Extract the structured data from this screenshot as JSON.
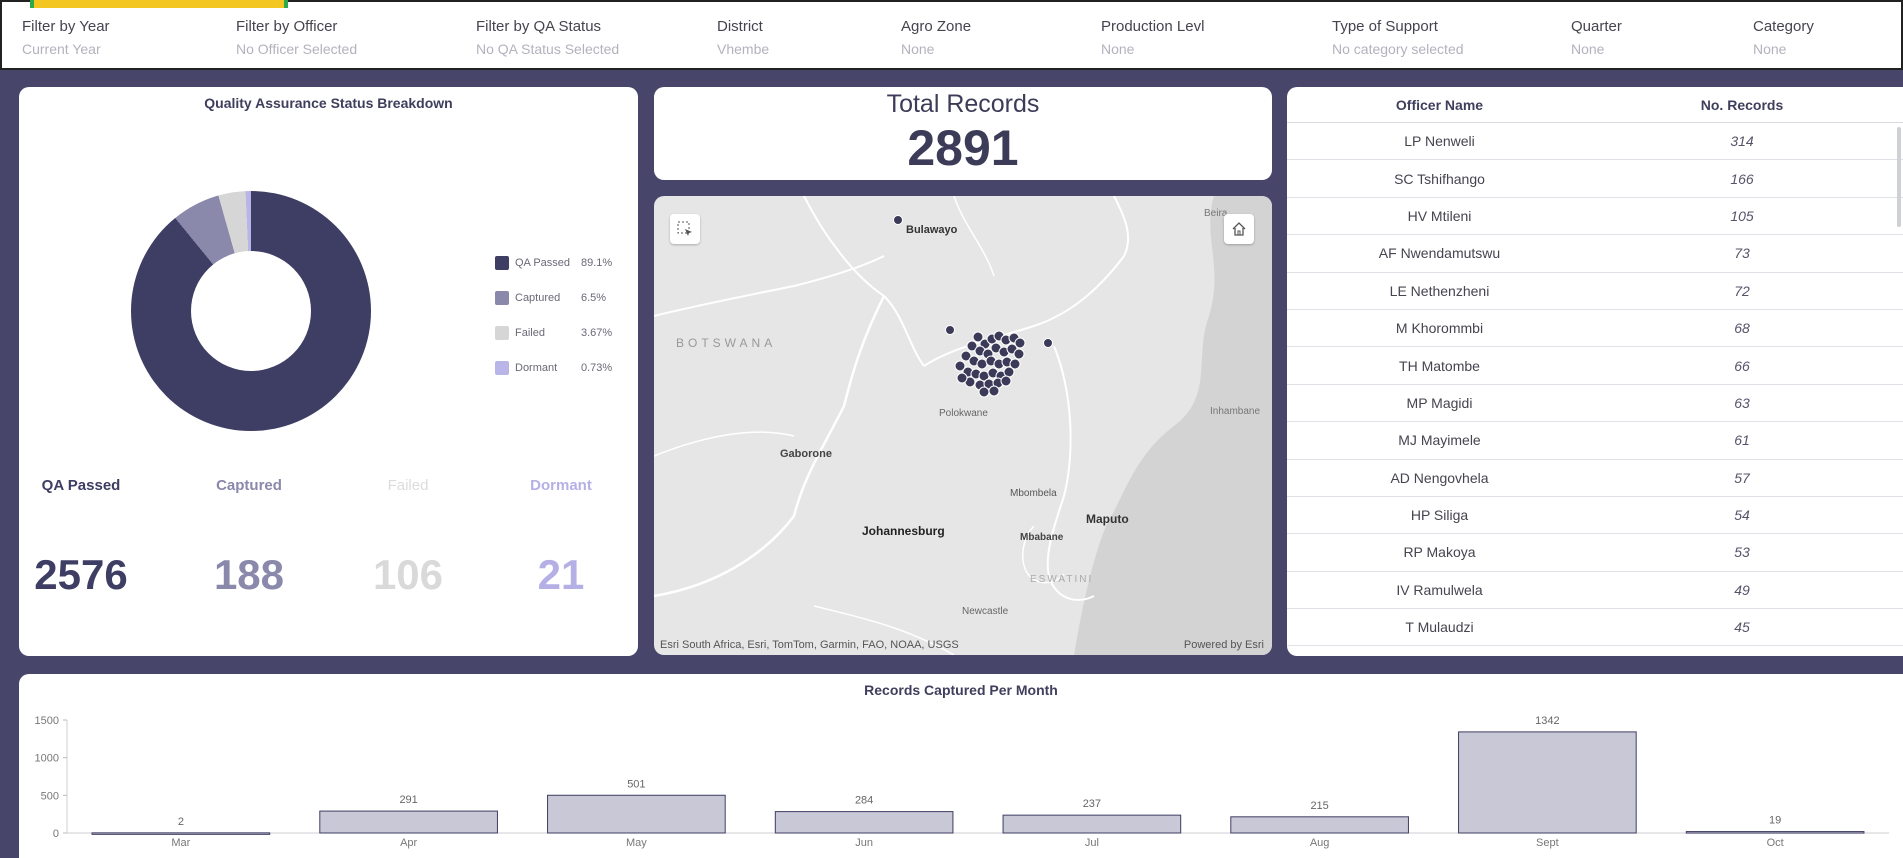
{
  "filters": [
    {
      "label": "Filter by Year",
      "value": "Current Year"
    },
    {
      "label": "Filter by Officer",
      "value": "No Officer Selected"
    },
    {
      "label": "Filter by QA Status",
      "value": "No QA Status Selected"
    },
    {
      "label": "District",
      "value": "Vhembe"
    },
    {
      "label": "Agro Zone",
      "value": "None"
    },
    {
      "label": "Production Levl",
      "value": "None"
    },
    {
      "label": "Type of Support",
      "value": "No category selected"
    },
    {
      "label": "Quarter",
      "value": "None"
    },
    {
      "label": "Category",
      "value": "None"
    }
  ],
  "qa": {
    "title": "Quality Assurance Status Breakdown",
    "legend": [
      {
        "label": "QA Passed",
        "pct": "89.1%",
        "color": "#3e3d63"
      },
      {
        "label": "Captured",
        "pct": "6.5%",
        "color": "#8a88ab"
      },
      {
        "label": "Failed",
        "pct": "3.67%",
        "color": "#d6d6d6"
      },
      {
        "label": "Dormant",
        "pct": "0.73%",
        "color": "#b9b5e8"
      }
    ],
    "stats": [
      {
        "name": "QA Passed",
        "value": "2576",
        "color": "#3e3d63"
      },
      {
        "name": "Captured",
        "value": "188",
        "color": "#8a88ab"
      },
      {
        "name": "Failed",
        "value": "106",
        "color": "#d9d9d9"
      },
      {
        "name": "Dormant",
        "value": "21",
        "color": "#b4b0e6"
      }
    ]
  },
  "total": {
    "title": "Total Records",
    "value": "2891"
  },
  "map": {
    "labels": {
      "bulawayo": "Bulawayo",
      "beira": "Beira",
      "botswana": "BOTSWANA",
      "polokwane": "Polokwane",
      "inhambane": "Inhambane",
      "gaborone": "Gaborone",
      "mbombela": "Mbombela",
      "maputo": "Maputo",
      "johannesburg": "Johannesburg",
      "mbabane": "Mbabane",
      "eswatini": "ESWATINI",
      "newcastle": "Newcastle"
    },
    "attribution": "Esri South Africa, Esri, TomTom, Garmin, FAO, NOAA, USGS",
    "powered": "Powered by Esri"
  },
  "officers": {
    "headers": {
      "name": "Officer Name",
      "records": "No. Records"
    },
    "rows": [
      {
        "name": "LP Nenweli",
        "records": "314"
      },
      {
        "name": "SC Tshifhango",
        "records": "166"
      },
      {
        "name": "HV Mtileni",
        "records": "105"
      },
      {
        "name": "AF Nwendamutswu",
        "records": "73"
      },
      {
        "name": "LE Nethenzheni",
        "records": "72"
      },
      {
        "name": "M Khorommbi",
        "records": "68"
      },
      {
        "name": "TH Matombe",
        "records": "66"
      },
      {
        "name": "MP Magidi",
        "records": "63"
      },
      {
        "name": "MJ Mayimele",
        "records": "61"
      },
      {
        "name": "AD Nengovhela",
        "records": "57"
      },
      {
        "name": "HP Siliga",
        "records": "54"
      },
      {
        "name": "RP Makoya",
        "records": "53"
      },
      {
        "name": "IV Ramulwela",
        "records": "49"
      },
      {
        "name": "T Mulaudzi",
        "records": "45"
      }
    ]
  },
  "chart_data": {
    "type": "bar",
    "title": "Records Captured Per Month",
    "categories": [
      "Mar",
      "Apr",
      "May",
      "Jun",
      "Jul",
      "Aug",
      "Sept",
      "Oct"
    ],
    "values": [
      2,
      291,
      501,
      284,
      237,
      215,
      1342,
      19
    ],
    "yticks": [
      0,
      500,
      1000,
      1500
    ],
    "ylim": [
      0,
      1500
    ],
    "bar_color": "#c9c8d6",
    "bar_stroke": "#3e3d63",
    "grid": false
  }
}
